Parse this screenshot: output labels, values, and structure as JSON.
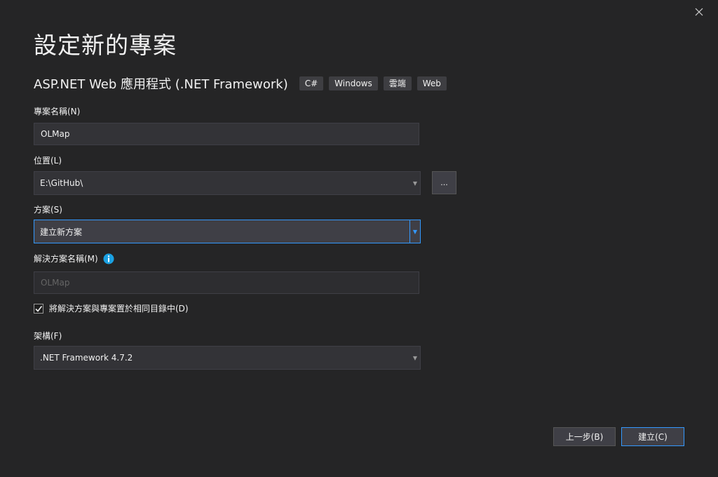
{
  "dialog": {
    "title": "設定新的專案",
    "subtitle": "ASP.NET Web 應用程式 (.NET Framework)",
    "tags": [
      "C#",
      "Windows",
      "雲端",
      "Web"
    ]
  },
  "fields": {
    "project_name": {
      "label": "專案名稱(N)",
      "value": "OLMap"
    },
    "location": {
      "label": "位置(L)",
      "value": "E:\\GitHub\\",
      "browse_label": "..."
    },
    "solution": {
      "label": "方案(S)",
      "value": "建立新方案"
    },
    "solution_name": {
      "label": "解決方案名稱(M)",
      "value": "OLMap"
    },
    "same_dir": {
      "label": "將解決方案與專案置於相同目錄中(D)",
      "checked": true
    },
    "framework": {
      "label": "架構(F)",
      "value": ".NET Framework 4.7.2"
    }
  },
  "buttons": {
    "back_label": "上一步(B)",
    "create_label": "建立(C)"
  },
  "icons": {
    "close": "close-icon",
    "info": "info-icon",
    "check": "check-icon",
    "dropdown": "chevron-down-icon"
  },
  "colors": {
    "background": "#252526",
    "accent": "#3399ff",
    "info_icon": "#1ba1e2"
  }
}
